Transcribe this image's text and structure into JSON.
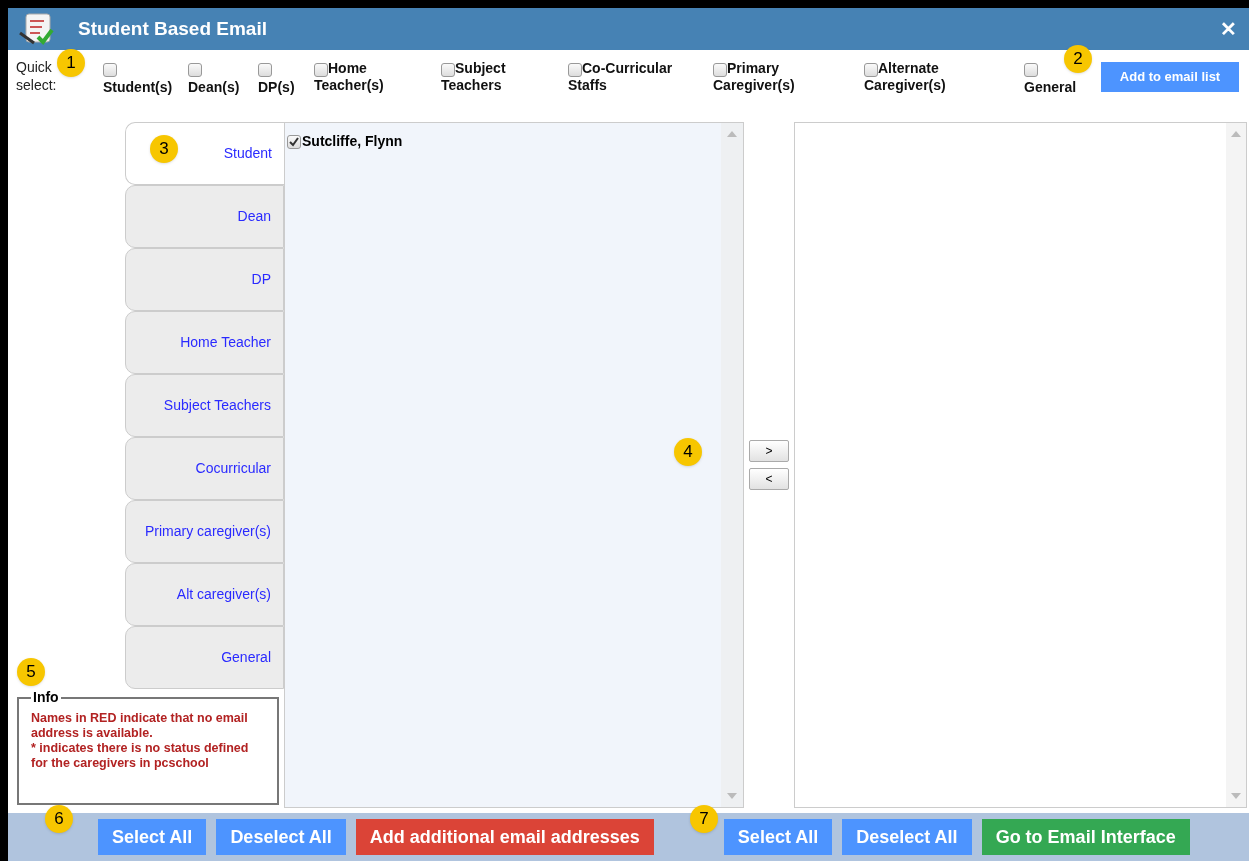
{
  "window": {
    "title": "Student Based Email",
    "close": "✕"
  },
  "quick_select": {
    "label": "Quick select:",
    "options": [
      {
        "kind": "above",
        "lines": [
          "Student(s)"
        ],
        "checked": false
      },
      {
        "kind": "above",
        "lines": [
          "Dean(s)"
        ],
        "checked": false
      },
      {
        "kind": "above",
        "lines": [
          "DP(s)"
        ],
        "checked": false
      },
      {
        "kind": "inline",
        "lines": [
          "Home",
          "Teacher(s)"
        ],
        "checked": false
      },
      {
        "kind": "inline",
        "lines": [
          "Subject",
          "Teachers"
        ],
        "checked": false
      },
      {
        "kind": "inline",
        "lines": [
          "Co-Curricular",
          "Staffs"
        ],
        "checked": false
      },
      {
        "kind": "inline",
        "lines": [
          "Primary",
          "Caregiver(s)"
        ],
        "checked": false
      },
      {
        "kind": "inline",
        "lines": [
          "Alternate",
          "Caregiver(s)"
        ],
        "checked": false
      },
      {
        "kind": "above",
        "lines": [
          "General"
        ],
        "checked": false
      }
    ],
    "button": "Add to email list"
  },
  "tabs": [
    {
      "label": "Student",
      "selected": true
    },
    {
      "label": "Dean",
      "selected": false
    },
    {
      "label": "DP",
      "selected": false
    },
    {
      "label": "Home Teacher",
      "selected": false
    },
    {
      "label": "Subject Teachers",
      "selected": false
    },
    {
      "label": "Cocurricular",
      "selected": false
    },
    {
      "label": "Primary caregiver(s)",
      "selected": false
    },
    {
      "label": "Alt caregiver(s)",
      "selected": false
    },
    {
      "label": "General",
      "selected": false
    }
  ],
  "source_list": [
    {
      "name": "Sutcliffe, Flynn",
      "checked": true
    }
  ],
  "move_buttons": [
    ">",
    "<"
  ],
  "info": {
    "title": "Info",
    "text": "Names in RED indicate that no email address is available.\n* indicates there is no status defined for the caregivers in pcschool"
  },
  "bottom_left": [
    "Select All",
    "Deselect All",
    "Add additional email addresses"
  ],
  "bottom_right": [
    "Select All",
    "Deselect All",
    "Go to Email Interface"
  ],
  "callouts": [
    "1",
    "2",
    "3",
    "4",
    "5",
    "6",
    "7"
  ]
}
